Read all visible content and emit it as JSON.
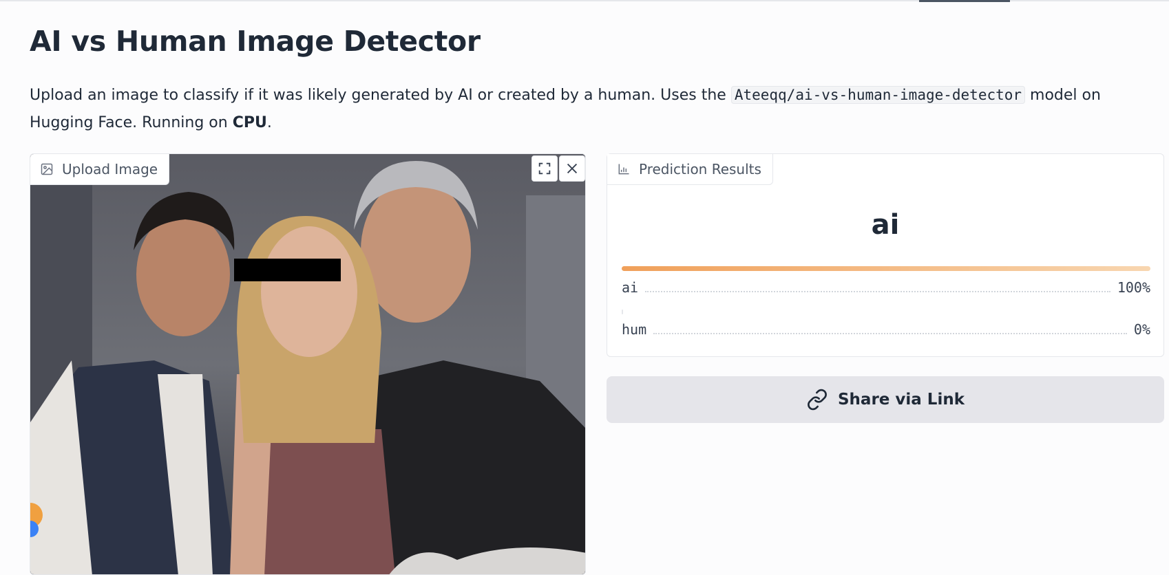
{
  "page": {
    "title": "AI vs Human Image Detector",
    "description": {
      "part1": "Upload an image to classify if it was likely generated by AI or created by a human. Uses the ",
      "model_code": "Ateeqq/ai-vs-human-image-detector",
      "part2": " model on Hugging Face. Running on ",
      "device": "CPU",
      "part3": "."
    }
  },
  "upload_panel": {
    "label": "Upload Image",
    "icon": "image-icon",
    "controls": [
      "fullscreen-icon",
      "close-icon"
    ]
  },
  "prediction_panel": {
    "label": "Prediction Results",
    "icon": "bar-chart-icon",
    "top_label": "ai",
    "confidences": [
      {
        "label": "ai",
        "value": "100%",
        "fraction": 1.0
      },
      {
        "label": "hum",
        "value": "0%",
        "fraction": 0.0
      }
    ]
  },
  "share_button": {
    "label": "Share via Link",
    "icon": "link-icon"
  },
  "colors": {
    "bar_start": "#f0a05a",
    "bar_end": "#f8d6b0",
    "share_bg": "#e5e5ea"
  }
}
